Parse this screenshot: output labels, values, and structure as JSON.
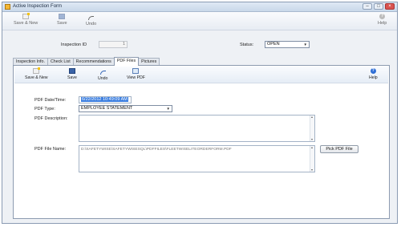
{
  "window": {
    "title": "Active Inspection Form",
    "minimize": "–",
    "maximize": "□",
    "close": "×"
  },
  "toolbar": {
    "save_new": "Save & New",
    "save": "Save",
    "undo": "Undo",
    "help": "Help"
  },
  "header": {
    "inspection_id_label": "Inspection ID",
    "inspection_id_value": "1",
    "status_label": "Status:",
    "status_value": "OPEN"
  },
  "tabs": [
    "Inspection Info.",
    "Check List",
    "Recommendations",
    "PDF Files",
    "Pictures"
  ],
  "active_tab": "PDF Files",
  "pdf_toolbar": {
    "save_new": "Save & New",
    "save": "Save",
    "undo": "Undo",
    "view_pdf": "View PDF",
    "help": "Help"
  },
  "form": {
    "date_label": "PDF Date/Time:",
    "date_value": "6/22/2012 10:49:09 AM",
    "type_label": "PDF Type:",
    "type_value": "EMPLOYEE STATEMENT",
    "description_label": "PDF Description:",
    "description_value": "",
    "filename_label": "PDF File Name:",
    "filename_value": "D:\\SAFETYWISE\\SAFETYWISESQL\\PDFFILES\\FLEETWISELITEORDERFORM.PDF",
    "pick_button": "Pick PDF File"
  },
  "icons": {
    "save_new": "new-document-icon",
    "save": "floppy-disk-icon",
    "undo": "undo-arrow-icon",
    "help": "help-icon",
    "view_pdf": "view-pdf-icon"
  }
}
